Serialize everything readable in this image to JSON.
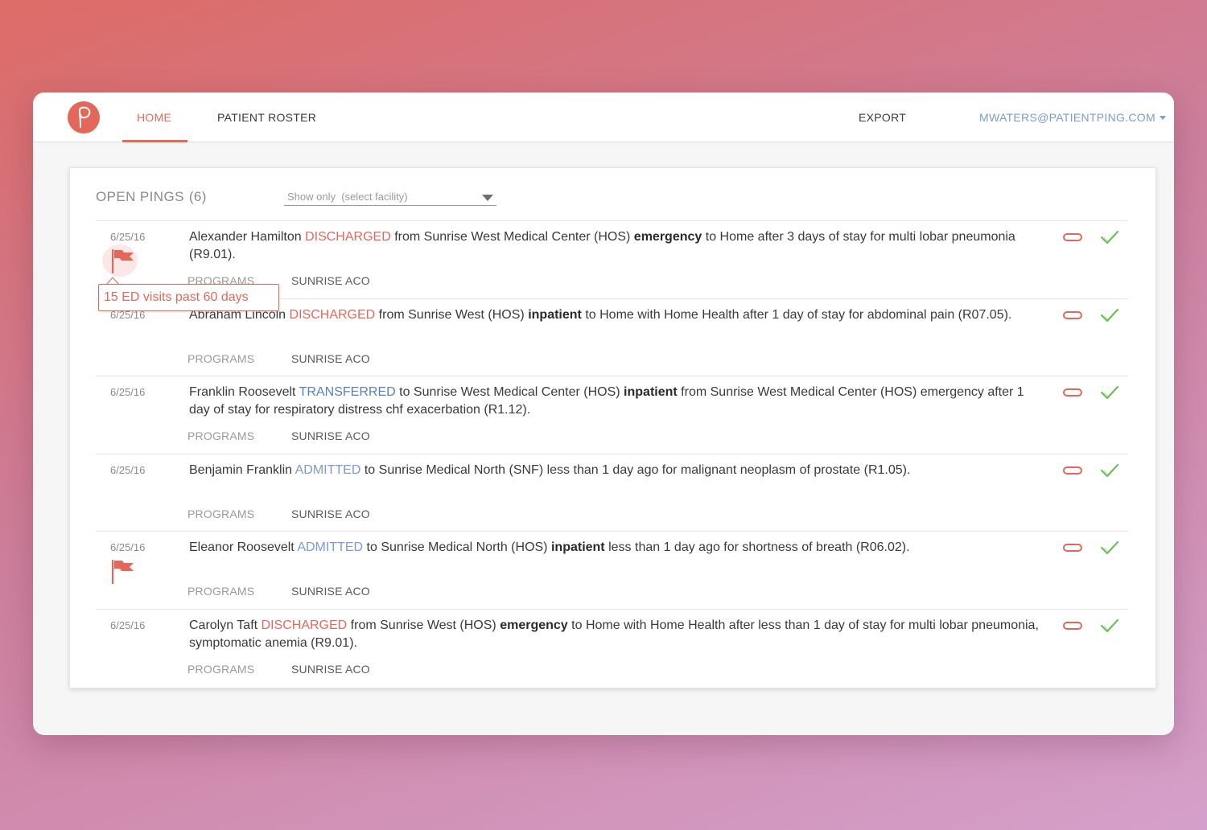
{
  "nav": {
    "logo_letter": "p",
    "home": "HOME",
    "roster": "PATIENT ROSTER",
    "export": "EXPORT",
    "user": "MWATERS@PATIENTPING.COM"
  },
  "panel": {
    "title": "OPEN PINGS",
    "count": "(6)",
    "filter_placeholder": "Show only  (select facility)"
  },
  "tooltip": "15 ED visits past 60 days",
  "colors": {
    "accent": "#e4685a",
    "link": "#7b9bd1",
    "transferred": "#5a7fbf",
    "confirm": "#6bbf59"
  },
  "icons": {
    "flag": "flag-icon",
    "dismiss": "dismiss-icon",
    "confirm": "check-icon"
  },
  "pings": [
    {
      "date": "6/25/16",
      "name": "Alexander Hamilton",
      "status": "DISCHARGED",
      "pre": "from Sunrise West Medical Center (HOS)",
      "type": "emergency",
      "post": "to Home after 3 days of stay for multi lobar pneumonia (R9.01).",
      "programs_label": "PROGRAMS",
      "program": "SUNRISE ACO"
    },
    {
      "date": "6/25/16",
      "name": "Abraham Lincoln",
      "status": "DISCHARGED",
      "pre": "from Sunrise West (HOS)",
      "type": "inpatient",
      "post": "to Home with Home Health after 1 day of stay for abdominal pain (R07.05).",
      "programs_label": "PROGRAMS",
      "program": "SUNRISE ACO"
    },
    {
      "date": "6/25/16",
      "name": "Franklin Roosevelt",
      "status": "TRANSFERRED",
      "pre": "to Sunrise West Medical Center (HOS)",
      "type": "inpatient",
      "post": "from Sunrise West Medical Center (HOS) emergency after 1 day of stay for respiratory distress chf exacerbation (R1.12).",
      "programs_label": "PROGRAMS",
      "program": "SUNRISE ACO"
    },
    {
      "date": "6/25/16",
      "name": "Benjamin Franklin",
      "status": "ADMITTED",
      "pre": "to Sunrise Medical North (SNF) less than 1 day ago for malignant neoplasm of prostate (R1.05).",
      "type": "",
      "post": "",
      "programs_label": "PROGRAMS",
      "program": "SUNRISE ACO"
    },
    {
      "date": "6/25/16",
      "name": "Eleanor Roosevelt",
      "status": "ADMITTED",
      "pre": "to Sunrise Medical North (HOS)",
      "type": "inpatient",
      "post": "less than 1 day ago for shortness of breath (R06.02).",
      "programs_label": "PROGRAMS",
      "program": "SUNRISE ACO"
    },
    {
      "date": "6/25/16",
      "name": "Carolyn Taft",
      "status": "DISCHARGED",
      "pre": "from Sunrise West (HOS)",
      "type": "emergency",
      "post": "to Home with Home Health after less than 1 day of stay for multi lobar pneumonia, symptomatic anemia (R9.01).",
      "programs_label": "PROGRAMS",
      "program": "SUNRISE ACO"
    }
  ]
}
